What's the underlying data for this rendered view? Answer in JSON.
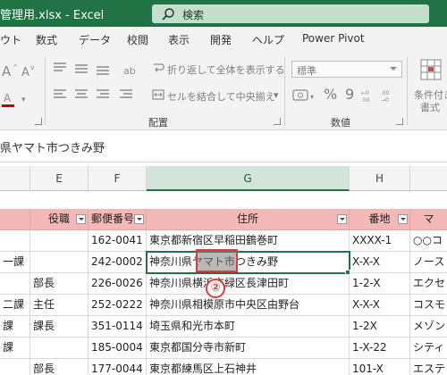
{
  "title_bar": {
    "title": "管理用.xlsx  -  Excel",
    "search_placeholder": "検索",
    "accent": "#217346"
  },
  "ribbon_tabs": [
    "ウト",
    "数式",
    "データ",
    "校閲",
    "表示",
    "開発",
    "ヘルプ",
    "Power Pivot"
  ],
  "ribbon": {
    "wrap_text": "折り返して全体を表示する",
    "merge_center": "セルを結合して中央揃え",
    "merge_dropdown": "▾",
    "number_format": "標準",
    "percent": "%",
    "comma": "9",
    "group_alignment": "配置",
    "group_number": "数値",
    "cond_format_line1": "条件付き",
    "cond_format_line2": "書式"
  },
  "formula_bar": {
    "content": "県ヤマト市つきみ野"
  },
  "grid": {
    "columns": [
      "E",
      "F",
      "G",
      "H",
      "ﾏ"
    ],
    "selected_column": "G",
    "header_row": {
      "d": "",
      "e": "役職",
      "f": "郵便番号",
      "g": "住所",
      "h": "番地",
      "i": "マ"
    },
    "rows": [
      {
        "d": "",
        "e": "",
        "f": "162-0041",
        "g": "東京都新宿区早稲田鶴巻町",
        "h": "XXXX-1",
        "i": "○○コ"
      },
      {
        "d": "一課",
        "e": "",
        "f": "242-0002",
        "g": "神奈川県ヤマト市つきみ野",
        "h": "X-X-X",
        "i": "ノース"
      },
      {
        "d": "",
        "e": "部長",
        "f": "226-0026",
        "g": "神奈川県横浜市緑区長津田町",
        "h": "1-2-X",
        "i": "エクセ"
      },
      {
        "d": "二課",
        "e": "主任",
        "f": "252-0222",
        "g": "神奈川県相模原市中央区由野台",
        "h": "X-X-X",
        "i": "コスモ"
      },
      {
        "d": "課",
        "e": "課長",
        "f": "351-0114",
        "g": "埼玉県和光市本町",
        "h": "1-2X",
        "i": "メゾン"
      },
      {
        "d": "課",
        "e": "",
        "f": "185-0004",
        "g": "東京都国分寺市新町",
        "h": "1-X-22",
        "i": "シティ"
      },
      {
        "d": "",
        "e": "部長",
        "f": "177-0044",
        "g": "東京都練馬区上石神井",
        "h": "101-X",
        "i": "エステ"
      }
    ]
  },
  "annotation": {
    "callout": "②",
    "color": "#e03b3b"
  },
  "colors": {
    "header_fill": "#f4b8b8",
    "selection": "#217346"
  }
}
